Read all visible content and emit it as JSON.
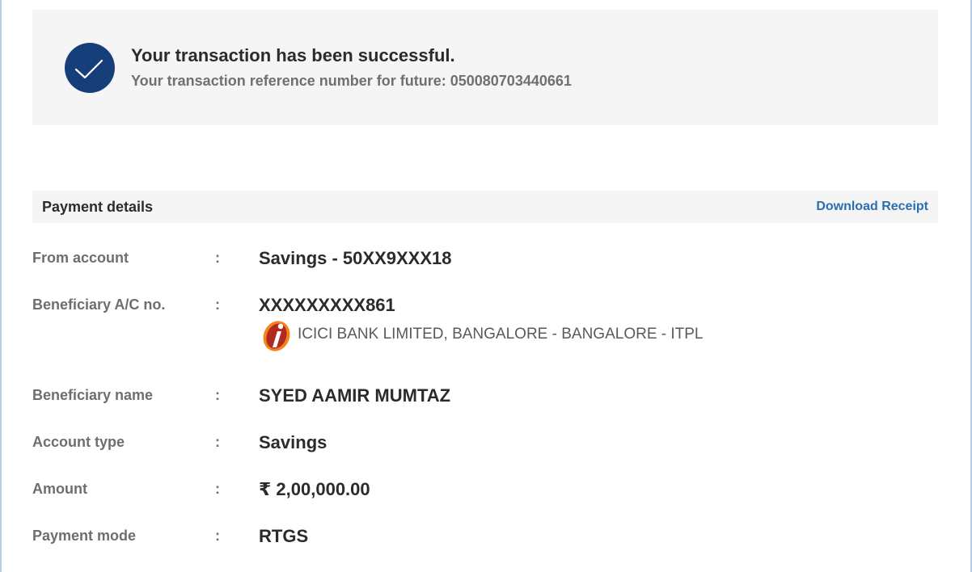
{
  "success": {
    "title": "Your transaction has been successful.",
    "reference": "Your transaction reference number for future: 050080703440661",
    "icon": "check-circle-icon",
    "icon_color": "#163e7a"
  },
  "details": {
    "title": "Payment details",
    "download_label": "Download Receipt",
    "link_color": "#2b6fb3",
    "rows": [
      {
        "label": "From account",
        "colon": ":",
        "value": "Savings - 50XX9XXX18"
      },
      {
        "label": "Beneficiary A/C no.",
        "colon": ":",
        "value": "XXXXXXXXX861",
        "bank": "ICICI BANK LIMITED, BANGALORE - BANGALORE - ITPL"
      },
      {
        "label": "Beneficiary name",
        "colon": ":",
        "value": "SYED AAMIR MUMTAZ"
      },
      {
        "label": "Account type",
        "colon": ":",
        "value": "Savings"
      },
      {
        "label": "Amount",
        "colon": ":",
        "value": "₹ 2,00,000.00"
      },
      {
        "label": "Payment mode",
        "colon": ":",
        "value": "RTGS"
      }
    ]
  }
}
